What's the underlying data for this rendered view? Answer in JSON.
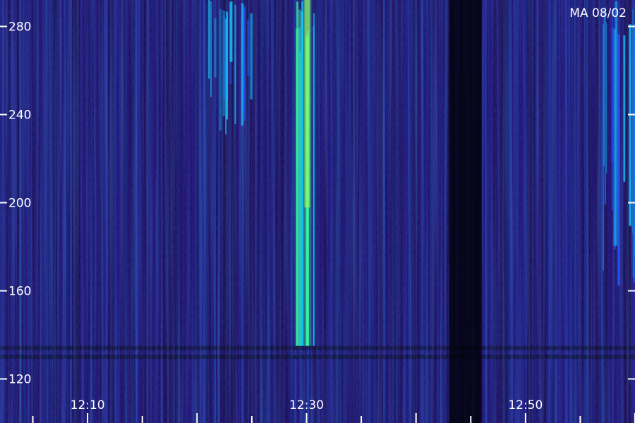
{
  "chart_data": {
    "type": "heatmap",
    "title": "",
    "xlabel": "",
    "ylabel": "",
    "stamp": "MA 08/02",
    "xlim": [
      "12:02",
      "13:00"
    ],
    "ylim": [
      100,
      292
    ],
    "x_ticks": [
      "12:10",
      "12:30",
      "12:50"
    ],
    "y_ticks": [
      120,
      160,
      200,
      240,
      280
    ],
    "grid": false,
    "legend": "none",
    "colormap": [
      "#000000",
      "#1a0a50",
      "#2a1bb0",
      "#1f5cff",
      "#14c8ff",
      "#3dff9a",
      "#d4ff2a"
    ],
    "features": [
      {
        "type": "burst",
        "start": "12:29",
        "end": "12:31",
        "peak_time": "12:30",
        "freq_range": [
          135,
          292
        ],
        "description": "strongest vertical emission band"
      },
      {
        "type": "band",
        "start": "12:21",
        "end": "12:25",
        "freq_range": [
          230,
          292
        ]
      },
      {
        "type": "band",
        "start": "12:57",
        "end": "13:00",
        "freq_range": [
          160,
          292
        ]
      },
      {
        "type": "gap",
        "start": "12:43",
        "end": "12:46",
        "freq_range": [
          100,
          292
        ]
      }
    ]
  }
}
